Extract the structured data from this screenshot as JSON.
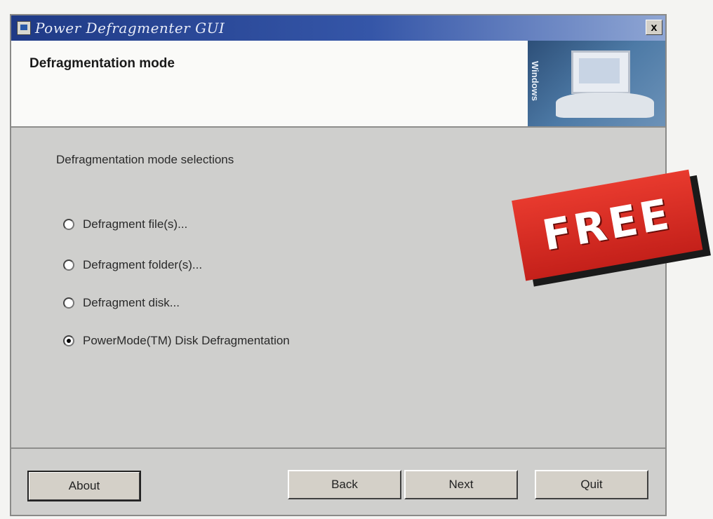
{
  "window": {
    "title": "Power Defragmenter GUI",
    "close_label": "x"
  },
  "header": {
    "title": "Defragmentation mode",
    "banner_text": "Windows"
  },
  "main": {
    "section_label": "Defragmentation mode selections",
    "options": [
      {
        "label": "Defragment file(s)...",
        "checked": false
      },
      {
        "label": "Defragment folder(s)...",
        "checked": false
      },
      {
        "label": "Defragment disk...",
        "checked": false
      },
      {
        "label": "PowerMode(TM) Disk Defragmentation",
        "checked": true
      }
    ]
  },
  "footer": {
    "about_label": "About",
    "back_label": "Back",
    "next_label": "Next",
    "quit_label": "Quit"
  },
  "overlay": {
    "badge_text": "FREE",
    "badge_color": "#d62a20"
  }
}
